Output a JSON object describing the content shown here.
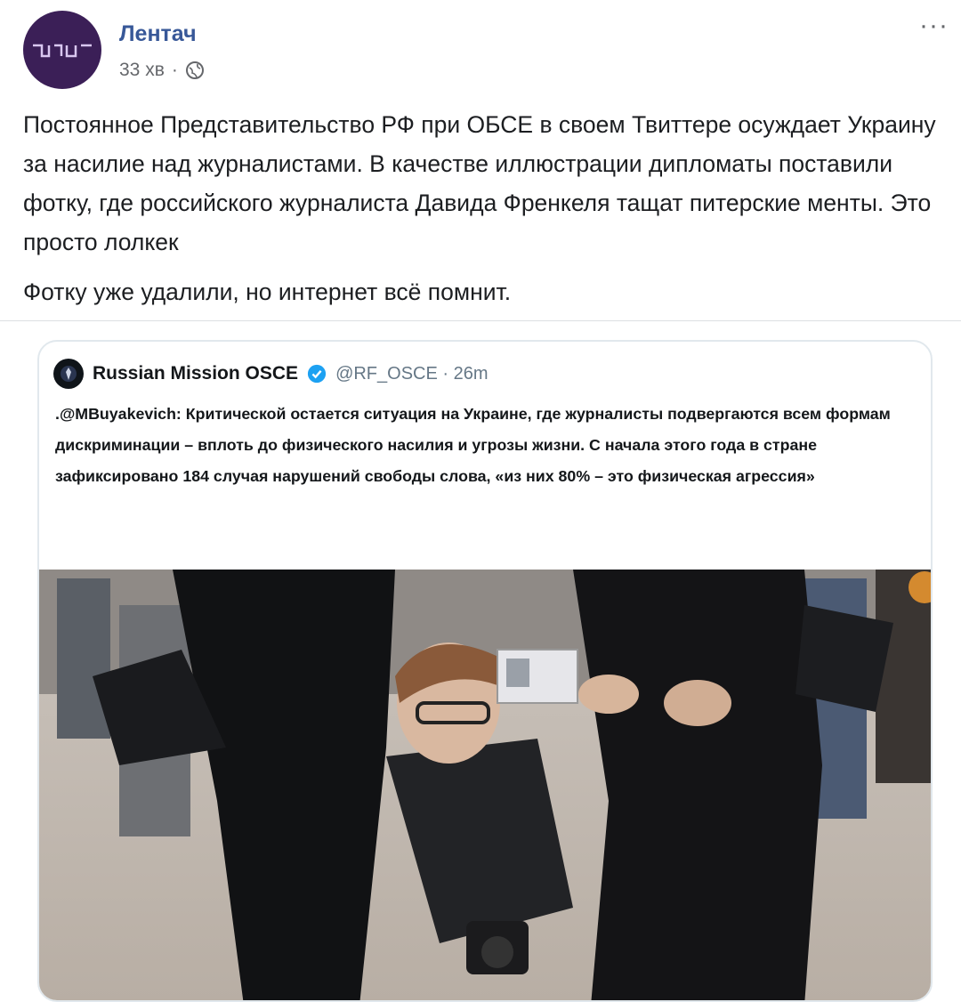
{
  "post": {
    "author": "Лентач",
    "time": "33 хв",
    "separator": "·",
    "more_label": "···",
    "paragraph_1": "Постоянное Представительство РФ при ОБСЕ в своем Твиттере осуждает Украину за насилие над журналистами. В качестве иллюстрации дипломаты поставили фотку, где российского журналиста Давида Френкеля тащат питерские менты. Это просто лолкек",
    "paragraph_2": "Фотку уже удалили, но интернет всё помнит."
  },
  "tweet": {
    "name": "Russian Mission OSCE",
    "handle": "@RF_OSCE · 26m",
    "text": ".@MBuyakevich: Критической остается ситуация на Украине, где журналисты подвергаются всем формам дискриминации – вплоть до физического насилия и угрозы жизни. С начала этого года в стране зафиксировано 184 случая нарушений свободы слова, «из них 80% – это физическая агрессия»"
  },
  "colors": {
    "author_link": "#385898",
    "avatar_bg": "#3b1f57",
    "verified_blue": "#1da1f2",
    "muted": "#65676b"
  },
  "icons": [
    "globe-icon",
    "verified-badge-icon",
    "more-options-icon"
  ]
}
